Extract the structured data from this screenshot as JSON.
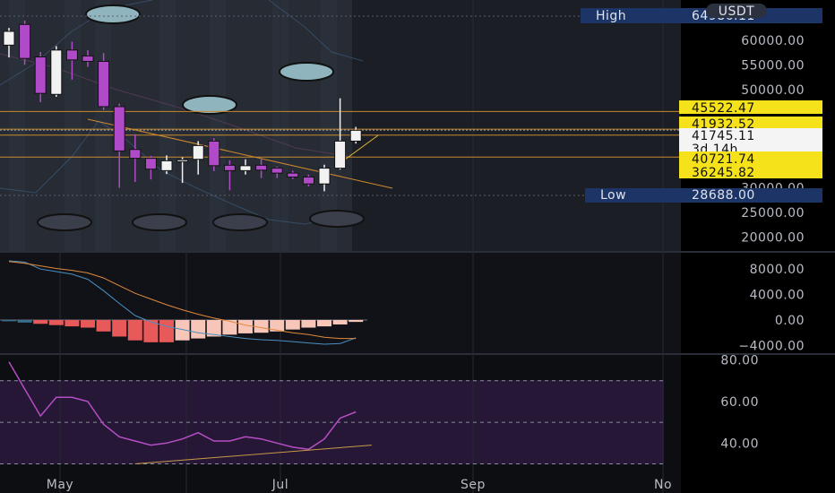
{
  "chart_data": [
    {
      "type": "candlestick",
      "title": "",
      "currency_label": "USDT",
      "high_label": "High",
      "high_value": "64986.11",
      "low_label": "Low",
      "low_value": "28688.00",
      "y_ticks": [
        "60000.00",
        "55000.00",
        "50000.00",
        "30000.00",
        "25000.00",
        "20000.00"
      ],
      "price_tags": [
        {
          "value": "45522.47",
          "style": "yellow"
        },
        {
          "value": "41932.52",
          "style": "yellow"
        },
        {
          "value": "41745.11",
          "style": "white"
        },
        {
          "value": "3d 14h",
          "style": "white"
        },
        {
          "value": "40721.74",
          "style": "yellow"
        },
        {
          "value": "36245.82",
          "style": "yellow"
        }
      ],
      "horizontal_levels": [
        45522.47,
        41932.52,
        40721.74,
        36245.82
      ],
      "candles": [
        {
          "o": 59000,
          "h": 62500,
          "l": 56500,
          "c": 61800
        },
        {
          "o": 63200,
          "h": 64000,
          "l": 55000,
          "c": 56300
        },
        {
          "o": 56600,
          "h": 57600,
          "l": 47400,
          "c": 49200
        },
        {
          "o": 49000,
          "h": 58800,
          "l": 48500,
          "c": 58000
        },
        {
          "o": 58000,
          "h": 59700,
          "l": 52000,
          "c": 56000
        },
        {
          "o": 56800,
          "h": 58000,
          "l": 54600,
          "c": 55700
        },
        {
          "o": 55700,
          "h": 57400,
          "l": 45800,
          "c": 46500
        },
        {
          "o": 46500,
          "h": 47100,
          "l": 30000,
          "c": 37500
        },
        {
          "o": 37800,
          "h": 40900,
          "l": 31200,
          "c": 36000
        },
        {
          "o": 36000,
          "h": 36500,
          "l": 31700,
          "c": 33800
        },
        {
          "o": 33500,
          "h": 36600,
          "l": 32800,
          "c": 35500
        },
        {
          "o": 35500,
          "h": 36200,
          "l": 31000,
          "c": 35700
        },
        {
          "o": 35800,
          "h": 39500,
          "l": 32700,
          "c": 38600
        },
        {
          "o": 39500,
          "h": 40100,
          "l": 33400,
          "c": 34500
        },
        {
          "o": 34600,
          "h": 35600,
          "l": 29500,
          "c": 33500
        },
        {
          "o": 33500,
          "h": 35800,
          "l": 32700,
          "c": 34500
        },
        {
          "o": 34600,
          "h": 35800,
          "l": 32000,
          "c": 33600
        },
        {
          "o": 34000,
          "h": 34300,
          "l": 32000,
          "c": 33000
        },
        {
          "o": 33000,
          "h": 33500,
          "l": 31800,
          "c": 32200
        },
        {
          "o": 32200,
          "h": 32700,
          "l": 30300,
          "c": 30800
        },
        {
          "o": 30800,
          "h": 34700,
          "l": 29300,
          "c": 34000
        },
        {
          "o": 34000,
          "h": 48200,
          "l": 33700,
          "c": 39500
        },
        {
          "o": 39500,
          "h": 42400,
          "l": 39000,
          "c": 41700
        }
      ],
      "x_ticks": [
        "May",
        "Jul",
        "Sep",
        "No"
      ]
    },
    {
      "type": "bar",
      "title": "",
      "y_ticks": [
        "8000.00",
        "4000.00",
        "0.00",
        "−4000.00"
      ],
      "histogram": [
        -200,
        -400,
        -600,
        -800,
        -1000,
        -1200,
        -1800,
        -2600,
        -3200,
        -3500,
        -3500,
        -3200,
        -2900,
        -2600,
        -2300,
        -2100,
        -2000,
        -1800,
        -1500,
        -1200,
        -1000,
        -700,
        -300
      ],
      "macd_line": [
        9300,
        9100,
        8000,
        7600,
        7200,
        6400,
        4600,
        2600,
        700,
        -300,
        -1000,
        -1500,
        -2000,
        -2300,
        -2600,
        -2900,
        -3100,
        -3200,
        -3400,
        -3600,
        -3800,
        -3700,
        -2800
      ],
      "signal_line": [
        9200,
        8900,
        8500,
        8100,
        7800,
        7400,
        6600,
        5400,
        4200,
        3300,
        2400,
        1600,
        900,
        300,
        -200,
        -800,
        -1200,
        -1600,
        -2000,
        -2300,
        -2700,
        -2900,
        -2900
      ]
    },
    {
      "type": "line",
      "title": "",
      "y_ticks": [
        "80.00",
        "60.00",
        "40.00"
      ],
      "rsi": [
        79,
        66,
        53,
        62,
        62,
        60,
        49,
        43,
        41,
        39,
        40,
        42,
        45,
        41,
        41,
        43,
        42,
        40,
        38,
        37,
        42,
        52,
        55
      ],
      "bands": [
        70,
        50,
        30
      ],
      "trendline": [
        [
          8,
          30
        ],
        [
          23,
          39
        ]
      ]
    }
  ]
}
